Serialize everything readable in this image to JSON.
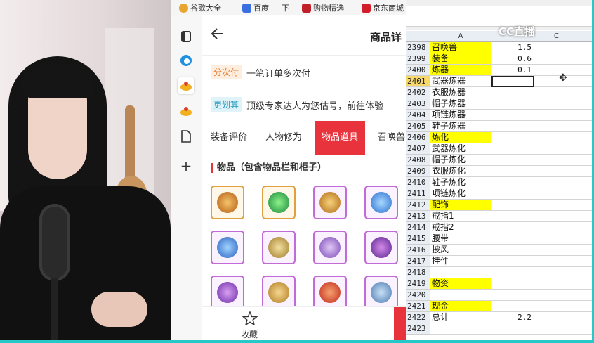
{
  "browser": {
    "bookmarks": [
      {
        "label": "谷歌大全",
        "icon": "folder-icon",
        "color": "#e8a630"
      },
      {
        "label": "百度",
        "icon": "baidu-icon",
        "color": "#3a6fe0"
      },
      {
        "label": "下",
        "icon": "download-icon",
        "color": "#888888"
      },
      {
        "label": "购物精选",
        "icon": "shop-icon",
        "color": "#c0202a"
      },
      {
        "label": "京东商城",
        "icon": "jd-icon",
        "color": "#d21e2b"
      }
    ],
    "sidebar_icons": [
      "tabs-icon",
      "edge-icon",
      "game-icon",
      "game-icon-2",
      "document-icon",
      "plus-icon"
    ],
    "page": {
      "title": "商品详",
      "promos": [
        {
          "tag": "分次付",
          "text": "一笔订单多次付",
          "tag_bg": "#fdeee0",
          "tag_color": "#e57a2b"
        },
        {
          "tag": "更划算",
          "text": "顶级专家达人为您估号，前往体验",
          "tag_bg": "#e0f3f8",
          "tag_color": "#2a9ec0"
        }
      ],
      "tabs": [
        "装备评价",
        "人物修为",
        "物品道具",
        "召唤兽"
      ],
      "active_tab": 2,
      "section_title": "物品（包含物品栏和柜子）",
      "footer": {
        "favorite_label": "收藏"
      }
    }
  },
  "sheet": {
    "col_headers": [
      "A",
      "",
      "C",
      ""
    ],
    "rows": [
      {
        "num": "2398",
        "a": "召唤兽",
        "b": "1.5",
        "a_yellow": true
      },
      {
        "num": "2399",
        "a": "装备",
        "b": "0.6",
        "a_yellow": true
      },
      {
        "num": "2400",
        "a": "炼器",
        "b": "0.1",
        "a_yellow": true
      },
      {
        "num": "2401",
        "a": "武器炼器",
        "b": "",
        "a_yellow": false,
        "selected": true
      },
      {
        "num": "2402",
        "a": "衣服炼器",
        "b": "",
        "a_yellow": false
      },
      {
        "num": "2403",
        "a": "帽子炼器",
        "b": "",
        "a_yellow": false
      },
      {
        "num": "2404",
        "a": "项链炼器",
        "b": "",
        "a_yellow": false
      },
      {
        "num": "2405",
        "a": "鞋子炼器",
        "b": "",
        "a_yellow": false
      },
      {
        "num": "2406",
        "a": "炼化",
        "b": "",
        "a_yellow": true
      },
      {
        "num": "2407",
        "a": "武器炼化",
        "b": "",
        "a_yellow": false
      },
      {
        "num": "2408",
        "a": "帽子炼化",
        "b": "",
        "a_yellow": false
      },
      {
        "num": "2409",
        "a": "衣服炼化",
        "b": "",
        "a_yellow": false
      },
      {
        "num": "2410",
        "a": "鞋子炼化",
        "b": "",
        "a_yellow": false
      },
      {
        "num": "2411",
        "a": "项链炼化",
        "b": "",
        "a_yellow": false
      },
      {
        "num": "2412",
        "a": "配饰",
        "b": "",
        "a_yellow": true
      },
      {
        "num": "2413",
        "a": "戒指1",
        "b": "",
        "a_yellow": false
      },
      {
        "num": "2414",
        "a": "戒指2",
        "b": "",
        "a_yellow": false
      },
      {
        "num": "2415",
        "a": "腰带",
        "b": "",
        "a_yellow": false
      },
      {
        "num": "2416",
        "a": "披风",
        "b": "",
        "a_yellow": false
      },
      {
        "num": "2417",
        "a": "挂件",
        "b": "",
        "a_yellow": false
      },
      {
        "num": "2418",
        "a": "",
        "b": "",
        "a_yellow": false
      },
      {
        "num": "2419",
        "a": "物资",
        "b": "",
        "a_yellow": true
      },
      {
        "num": "2420",
        "a": "",
        "b": "",
        "a_yellow": false
      },
      {
        "num": "2421",
        "a": "现金",
        "b": "",
        "a_yellow": true
      },
      {
        "num": "2422",
        "a": "总计",
        "b": "2.2",
        "a_yellow": false
      },
      {
        "num": "2423",
        "a": "",
        "b": "",
        "a_yellow": false
      }
    ]
  },
  "overlay": {
    "logo": "CC直播"
  },
  "item_colors": [
    "#e38b1f",
    "#2fb84a",
    "#d48a20",
    "#3a8ee0",
    "#3a7fd0",
    "#c9a233",
    "#9a6ad0",
    "#7d3ab8",
    "#8e4cc4",
    "#d5a030",
    "#d8442a",
    "#6a9ccf"
  ],
  "colors": {
    "accent_red": "#e8323c",
    "excel_yellow": "#ffff00",
    "stream_border": "#27c8c8"
  }
}
